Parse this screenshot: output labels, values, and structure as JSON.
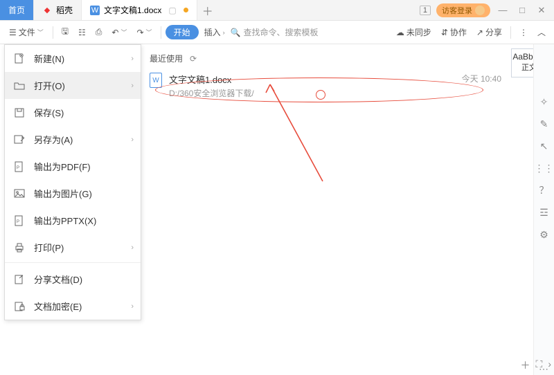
{
  "tabs": {
    "home": "首页",
    "docker": "稻壳",
    "doc": "文字文稿1.docx"
  },
  "title_right": {
    "window_badge": "1",
    "login": "访客登录"
  },
  "toolbar": {
    "file": "文件",
    "start": "开始",
    "insert": "插入",
    "search_placeholder": "查找命令、搜索模板",
    "not_sync": "未同步",
    "collab": "协作",
    "share": "分享"
  },
  "style_chip": {
    "sample": "AaBbCcI",
    "name": "正文"
  },
  "file_menu": [
    {
      "label": "新建(N)",
      "has_sub": true
    },
    {
      "label": "打开(O)",
      "has_sub": true,
      "selected": true
    },
    {
      "label": "保存(S)",
      "has_sub": false
    },
    {
      "label": "另存为(A)",
      "has_sub": true
    },
    {
      "label": "输出为PDF(F)",
      "has_sub": false
    },
    {
      "label": "输出为图片(G)",
      "has_sub": false
    },
    {
      "label": "输出为PPTX(X)",
      "has_sub": false
    },
    {
      "label": "打印(P)",
      "has_sub": true
    },
    {
      "label": "分享文档(D)",
      "has_sub": false
    },
    {
      "label": "文档加密(E)",
      "has_sub": true
    }
  ],
  "recent": {
    "title": "最近使用",
    "doc_mark": "W",
    "doc_name": "文字文稿1.docx",
    "doc_path": "D:/360安全浏览器下载/",
    "doc_time": "今天  10:40"
  }
}
